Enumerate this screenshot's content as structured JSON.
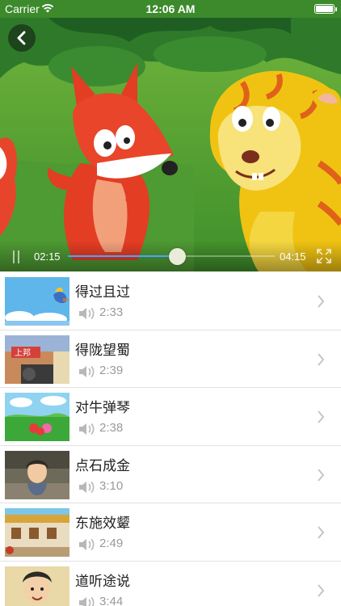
{
  "status_bar": {
    "carrier": "Carrier",
    "time": "12:06 AM"
  },
  "player": {
    "current_time": "02:15",
    "total_time": "04:15",
    "progress_fraction": 0.53,
    "accent_color": "#4aa3ff"
  },
  "icons": {
    "back": "chevron-left-icon",
    "pause": "pause-icon",
    "fullscreen": "fullscreen-icon",
    "speaker": "speaker-icon",
    "chevron": "chevron-right-icon"
  },
  "episodes": [
    {
      "title": "得过且过",
      "duration": "2:33"
    },
    {
      "title": "得陇望蜀",
      "duration": "2:39"
    },
    {
      "title": "对牛弹琴",
      "duration": "2:38"
    },
    {
      "title": "点石成金",
      "duration": "3:10"
    },
    {
      "title": "东施效颦",
      "duration": "2:49"
    },
    {
      "title": "道听途说",
      "duration": "3:44"
    }
  ],
  "thumbnail_signs": {
    "episode_2": "上邦"
  }
}
